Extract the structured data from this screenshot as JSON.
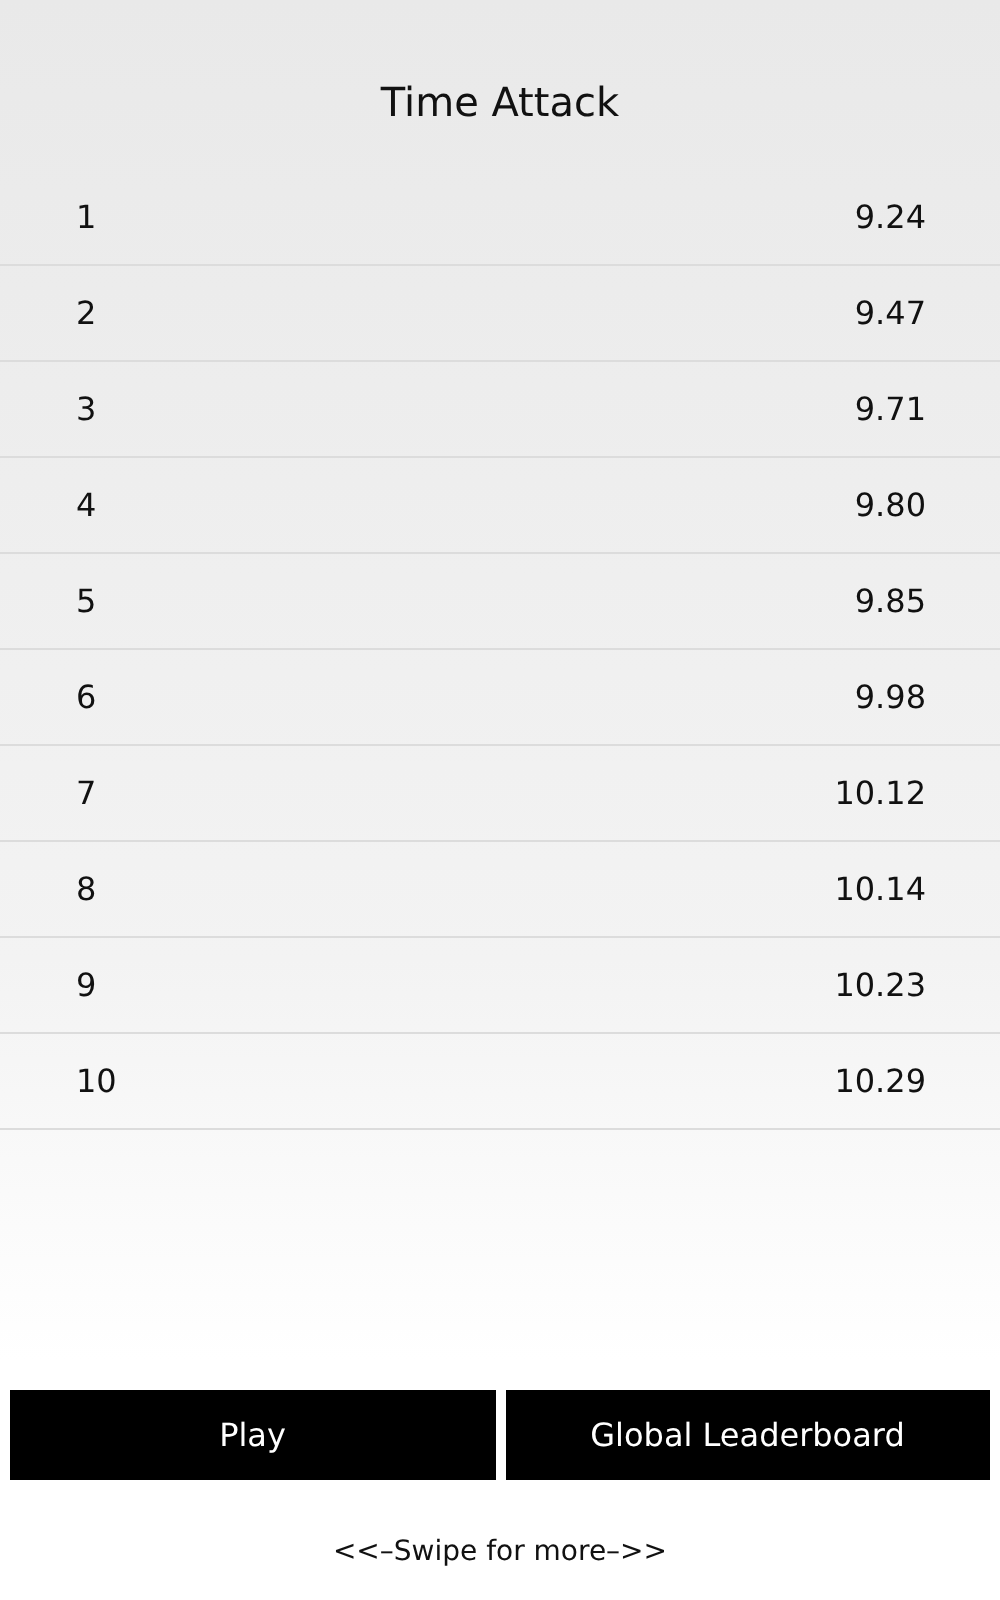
{
  "title": "Time Attack",
  "scores": [
    {
      "rank": "1",
      "time": "9.24"
    },
    {
      "rank": "2",
      "time": "9.47"
    },
    {
      "rank": "3",
      "time": "9.71"
    },
    {
      "rank": "4",
      "time": "9.80"
    },
    {
      "rank": "5",
      "time": "9.85"
    },
    {
      "rank": "6",
      "time": "9.98"
    },
    {
      "rank": "7",
      "time": "10.12"
    },
    {
      "rank": "8",
      "time": "10.14"
    },
    {
      "rank": "9",
      "time": "10.23"
    },
    {
      "rank": "10",
      "time": "10.29"
    }
  ],
  "buttons": [
    "Play",
    "Global Leaderboard"
  ],
  "footer": "<<–Swipe for more–>>"
}
